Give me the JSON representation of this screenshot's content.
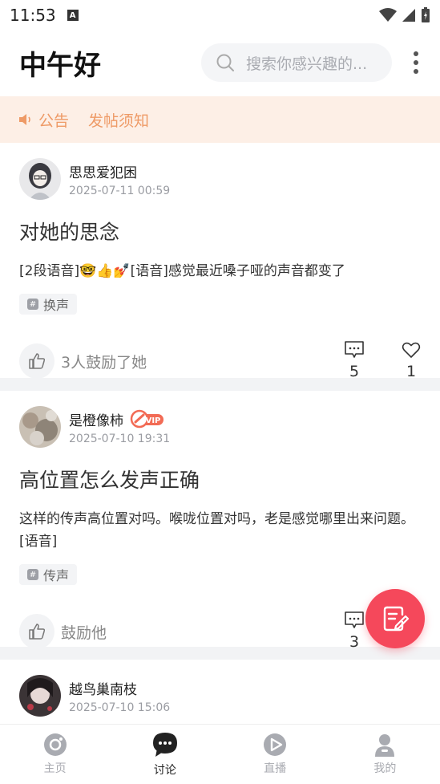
{
  "status_bar": {
    "time": "11:53"
  },
  "header": {
    "greeting": "中午好",
    "search_placeholder": "搜索你感兴趣的..."
  },
  "notice": {
    "announcement": "公告",
    "posting_rules": "发帖须知"
  },
  "posts": [
    {
      "author": "思思爱犯困",
      "time": "2025-07-11 00:59",
      "title": "对她的思念",
      "body": "[2段语音]🤓👍💅[语音]感觉最近嗓子哑的声音都变了",
      "tag": "换声",
      "cheer": "3人鼓励了她",
      "comments": "5",
      "likes": "1"
    },
    {
      "author": "是橙像柿",
      "time": "2025-07-10 19:31",
      "title": "高位置怎么发声正确",
      "body": "这样的传声高位置对吗。喉咙位置对吗，老是感觉哪里出来问题。[语音]",
      "tag": "传声",
      "cheer": "鼓励他",
      "comments": "3"
    },
    {
      "author": "越鸟巢南枝",
      "time": "2025-07-10 15:06"
    }
  ],
  "bottom_nav": [
    {
      "label": "主页",
      "icon": "home-disc-icon"
    },
    {
      "label": "讨论",
      "icon": "chat-bubble-icon"
    },
    {
      "label": "直播",
      "icon": "live-play-icon"
    },
    {
      "label": "我的",
      "icon": "user-icon"
    }
  ],
  "colors": {
    "accent": "#f5485b",
    "notice_bg": "#fdefe6",
    "notice_text": "#ee9a66"
  }
}
